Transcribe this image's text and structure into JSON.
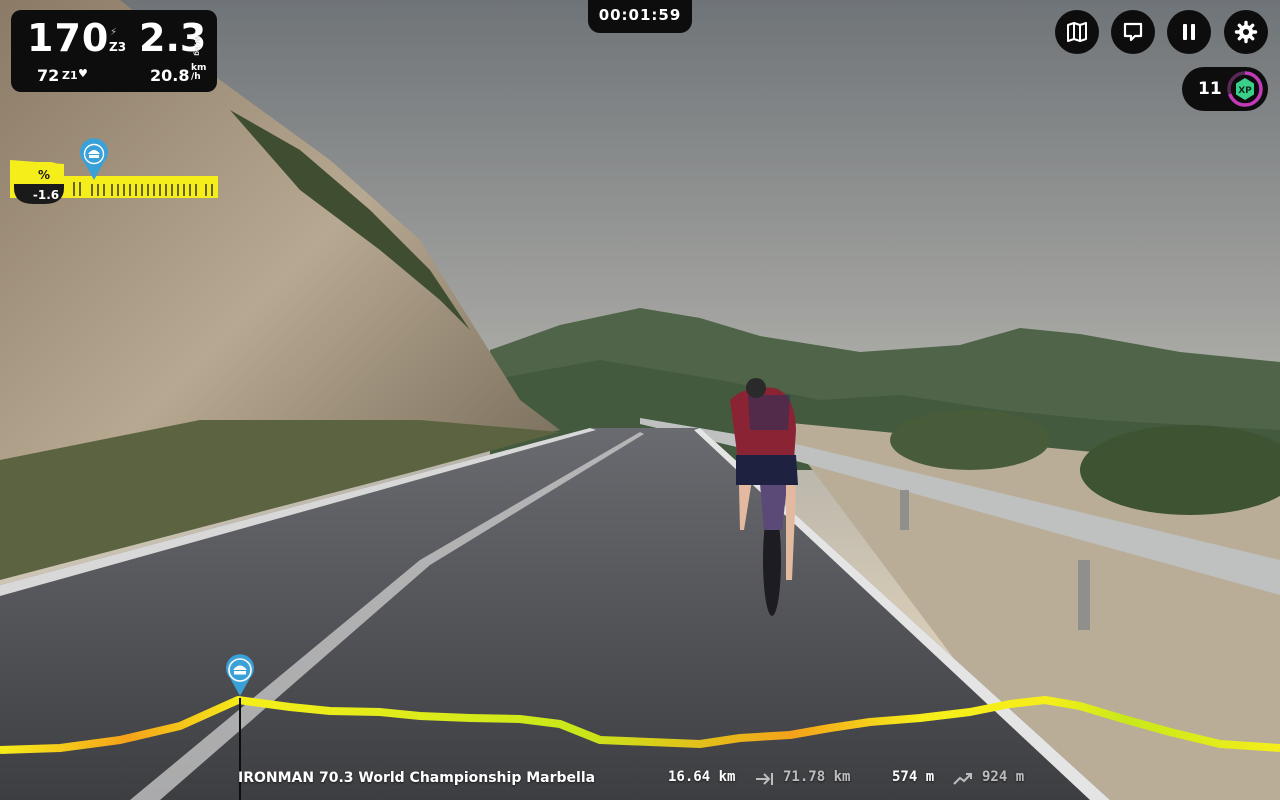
{
  "metrics": {
    "power": "170",
    "power_zone": "Z3",
    "wkg": "2.3",
    "wkg_unit": "W/kg",
    "heart_rate": "72",
    "hr_zone": "Z1",
    "speed": "20.8",
    "speed_unit_top": "km",
    "speed_unit_bottom": "/h",
    "icons": {
      "power": "lightning-icon",
      "heart": "heart-icon"
    }
  },
  "timer": "00:01:59",
  "controls": {
    "buttons": [
      {
        "name": "map-button",
        "icon": "map-icon"
      },
      {
        "name": "chat-button",
        "icon": "chat-icon"
      },
      {
        "name": "pause-button",
        "icon": "pause-icon"
      },
      {
        "name": "settings-button",
        "icon": "gear-icon"
      }
    ]
  },
  "xp": {
    "value": "11",
    "label": "XP"
  },
  "gradient": {
    "symbol": "%",
    "value": "-1.6"
  },
  "route": {
    "name": "IRONMAN 70.3 World Championship Marbella",
    "distance_done": "16.64 km",
    "distance_total": "71.78 km",
    "elevation_done": "574 m",
    "elevation_total": "924 m"
  },
  "colors": {
    "panel": "#0d0d0d",
    "profile_yellow": "#f5ee1a",
    "profile_orange": "#f5a21a",
    "marker_blue": "#3aa0d8",
    "xp_ring": "#c23ab8",
    "xp_badge": "#3ad08a"
  }
}
